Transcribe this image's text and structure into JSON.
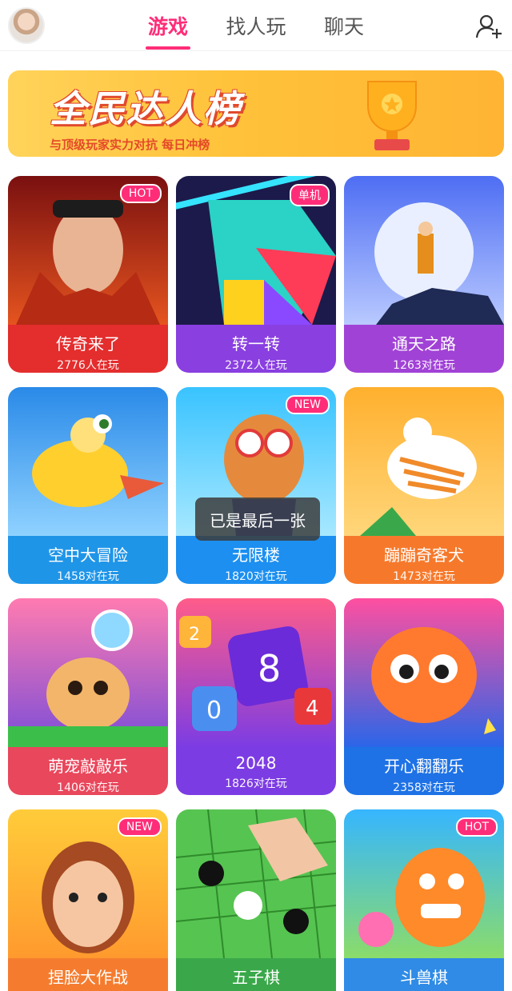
{
  "header": {
    "tabs": [
      {
        "label": "游戏",
        "active": true
      },
      {
        "label": "找人玩",
        "active": false
      },
      {
        "label": "聊天",
        "active": false
      }
    ],
    "accent": "#ff2d78"
  },
  "banner": {
    "title": "全民达人榜",
    "subtitle": "与顶级玩家实力对抗 每日冲榜"
  },
  "games": [
    {
      "name": "传奇来了",
      "players": "2776人在玩",
      "badge": "HOT",
      "foot_color": "#e42d2d"
    },
    {
      "name": "转一转",
      "players": "2372人在玩",
      "badge": "单机",
      "foot_color": "#8a3fe0"
    },
    {
      "name": "通天之路",
      "players": "1263对在玩",
      "badge": "",
      "foot_color": "#a142d6"
    },
    {
      "name": "空中大冒险",
      "players": "1458对在玩",
      "badge": "",
      "foot_color": "#1f95e8"
    },
    {
      "name": "无限楼",
      "players": "1820对在玩",
      "badge": "NEW",
      "foot_color": "#1c8ff0"
    },
    {
      "name": "蹦蹦奇客犬",
      "players": "1473对在玩",
      "badge": "",
      "foot_color": "#f6792b"
    },
    {
      "name": "萌宠敲敲乐",
      "players": "1406对在玩",
      "badge": "",
      "foot_color": "#e9475c"
    },
    {
      "name": "2048",
      "players": "1826对在玩",
      "badge": "",
      "foot_color": "#7c3ce3"
    },
    {
      "name": "开心翻翻乐",
      "players": "2358对在玩",
      "badge": "",
      "foot_color": "#1e72e6"
    },
    {
      "name": "捏脸大作战",
      "players": "",
      "badge": "NEW",
      "foot_color": "#f57c2f"
    },
    {
      "name": "五子棋",
      "players": "",
      "badge": "",
      "foot_color": "#3aa84a"
    },
    {
      "name": "斗兽棋",
      "players": "",
      "badge": "HOT",
      "foot_color": "#2f8be6"
    }
  ],
  "toast": "已是最后一张"
}
